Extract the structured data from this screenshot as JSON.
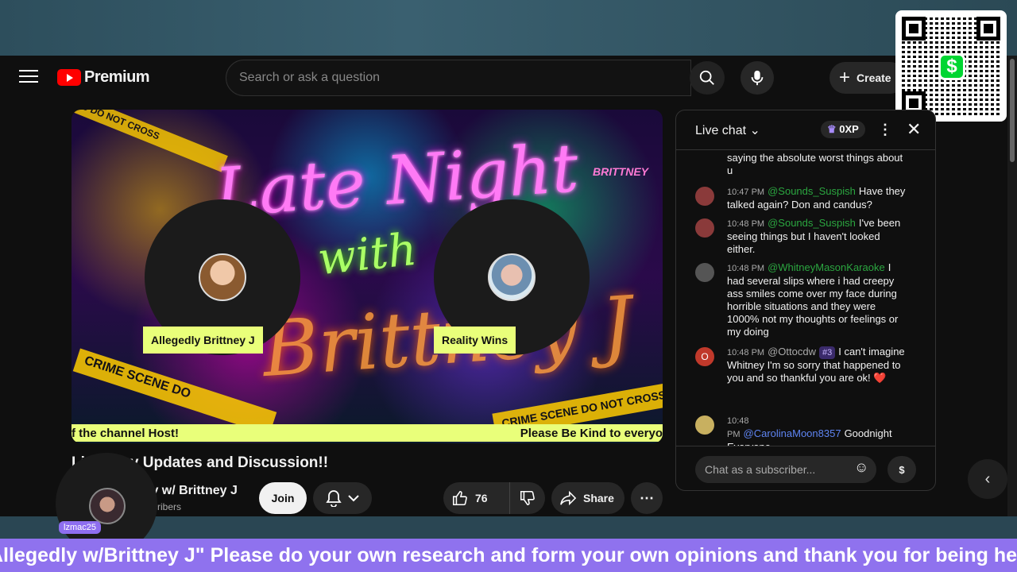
{
  "header": {
    "logo_text": "Premium",
    "search_placeholder": "Search or ask a question",
    "create_label": "Create"
  },
  "video": {
    "brand": "BRITTNEY",
    "tape_top": "9 DO NOT CROSS",
    "tape_left": "CRIME SCENE DO",
    "tape_right": "CRIME SCENE DO NOT CROSS",
    "art_line1": "Late Night",
    "art_line2": "with",
    "art_line3": "Brittney J",
    "guest1_name": "Allegedly Brittney J",
    "guest2_name": "Reality Wins",
    "ticker_left": "f the channel Host!",
    "ticker_right": "Please Be Kind to everyo"
  },
  "below": {
    "title": "Li      Clancy Updates and Discussion!!",
    "channel_name": "ly w/ Brittney J",
    "subscribers": "scribers",
    "join_label": "Join",
    "like_count": "76",
    "share_label": "Share"
  },
  "overlay": {
    "username": "lzmac25"
  },
  "chat": {
    "title": "Live chat",
    "xp": "0XP",
    "input_placeholder": "Chat as a subscriber...",
    "messages": [
      {
        "time": "",
        "user": "",
        "text": "saying the absolute worst things about u"
      },
      {
        "time": "10:47 PM",
        "user": "@Sounds_Suspish",
        "text": "Have they talked again? Don and candus?"
      },
      {
        "time": "10:48 PM",
        "user": "@Sounds_Suspish",
        "text": "I've been seeing things but I haven't looked either."
      },
      {
        "time": "10:48 PM",
        "user": "@WhitneyMasonKaraoke",
        "text": "I had several slips where i had creepy ass smiles come over my face during horrible situations and they were 1000% not my thoughts or feelings or my doing"
      },
      {
        "time": "10:48 PM",
        "user": "@Ottocdw",
        "rank": "#3",
        "text": "I can't imagine Whitney I'm so sorry that happened to you and so thankful you are ok! ❤️"
      },
      {
        "time": "10:48 PM",
        "user": "@CarolinaMoon8357",
        "text": "Goodnight Everyone"
      }
    ]
  },
  "banner": {
    "text": "Allegedly w/Brittney J\" Please do your own research and form your own opinions and thank you for being here"
  },
  "colors": {
    "accent_red": "#ff0000",
    "ticker": "#e9ff7a",
    "banner": "#8f72ee",
    "chat_user_green": "#2ba640",
    "chat_user_blue": "#5e84f1"
  }
}
